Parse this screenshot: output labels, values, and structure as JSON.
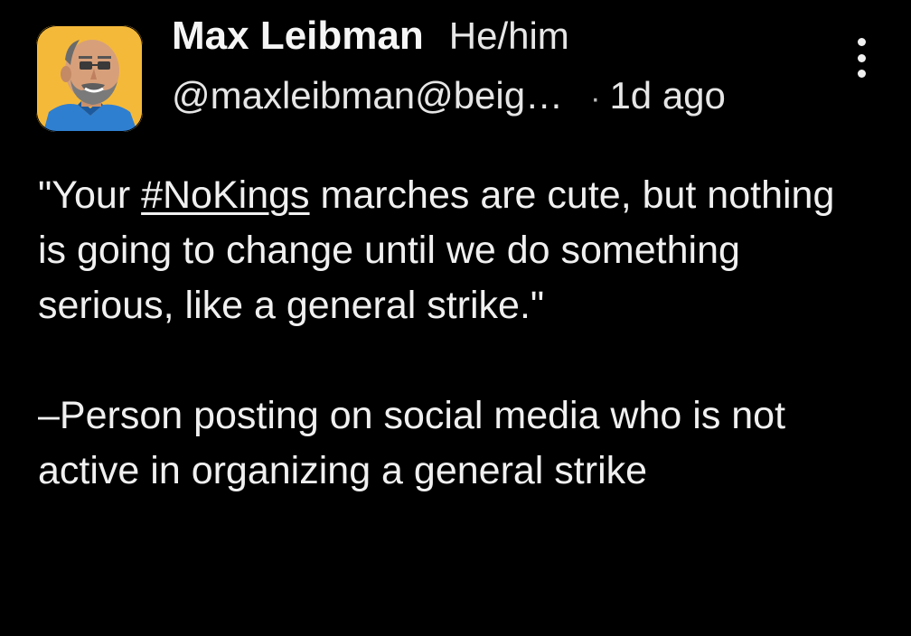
{
  "author": {
    "display_name": "Max Leibman",
    "pronouns": "He/him",
    "handle": "@maxleibman@beig…",
    "separator": "·",
    "time_ago": "1d ago"
  },
  "menu": {
    "icon": "more-vertical-icon"
  },
  "post": {
    "paragraph1": {
      "before_tag": "\"Your ",
      "hashtag": "#NoKings",
      "after_tag": " marches are cute, but nothing is going to change until we do something serious, like a general strike.\""
    },
    "paragraph2": "–Person posting on social media who is not active in organizing a general strike"
  },
  "colors": {
    "background": "#000000",
    "text": "#f0f0f0",
    "avatar_background": "#f5b93a"
  }
}
